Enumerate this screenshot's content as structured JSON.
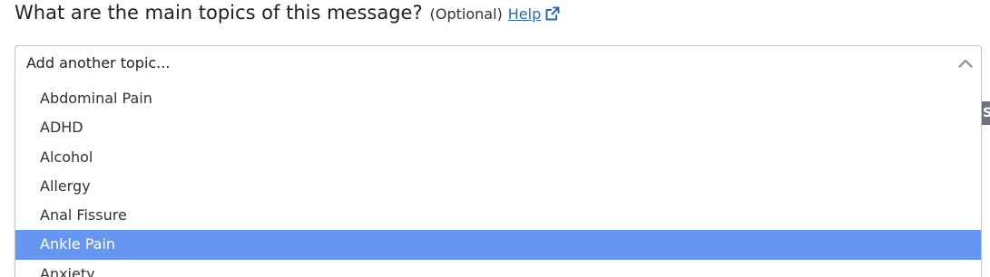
{
  "question": {
    "text": "What are the main topics of this message?",
    "optional": "(Optional)",
    "help_label": "Help",
    "help_icon": "external-link-icon"
  },
  "topic_select": {
    "placeholder": "Add another topic...",
    "toggle_icon": "chevron-up-icon",
    "expanded": true,
    "options": [
      "Abdominal Pain",
      "ADHD",
      "Alcohol",
      "Allergy",
      "Anal Fissure",
      "Ankle Pain",
      "Anxiety"
    ],
    "highlighted_option": "Ankle Pain"
  },
  "background_badge": {
    "text": "S"
  },
  "colors": {
    "link": "#2a6bb8",
    "highlight": "#6496f2",
    "border": "#c6c6c6",
    "badge": "#6b7480"
  }
}
